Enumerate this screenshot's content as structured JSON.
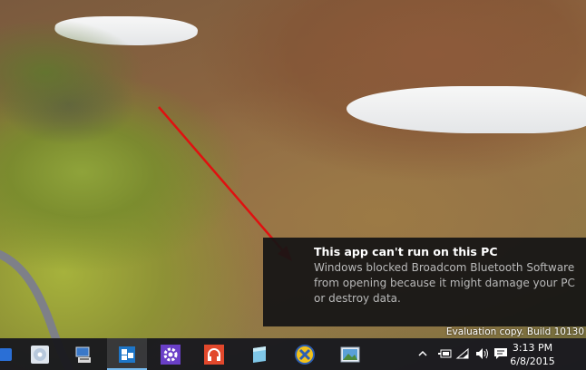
{
  "notification": {
    "title": "This app can't run on this PC",
    "message": "Windows blocked Broadcom Bluetooth Software from opening because it might damage your PC or destroy data."
  },
  "watermark": {
    "text": "Evaluation copy. Build 10130"
  },
  "taskbar": {
    "apps": [
      {
        "name": "app-1",
        "icon": "generic-app-icon"
      },
      {
        "name": "app-2",
        "icon": "disc-icon"
      },
      {
        "name": "app-3",
        "icon": "computer-icon"
      },
      {
        "name": "app-4",
        "icon": "tiles-icon",
        "active": true
      },
      {
        "name": "app-5",
        "icon": "gear-icon"
      },
      {
        "name": "app-6",
        "icon": "headphones-icon"
      },
      {
        "name": "app-7",
        "icon": "notes-icon"
      },
      {
        "name": "app-8",
        "icon": "x-icon"
      },
      {
        "name": "app-9",
        "icon": "picture-icon"
      }
    ],
    "tray_icons": [
      "chevron-up-icon",
      "battery-icon",
      "wifi-icon",
      "volume-icon",
      "action-center-icon"
    ],
    "clock": {
      "time": "3:13 PM",
      "date": "6/8/2015"
    }
  },
  "colors": {
    "taskbar_bg": "#1a1a1f",
    "toast_bg": "#141414",
    "arrow": "#e01010",
    "accent": "#76b9ed"
  }
}
